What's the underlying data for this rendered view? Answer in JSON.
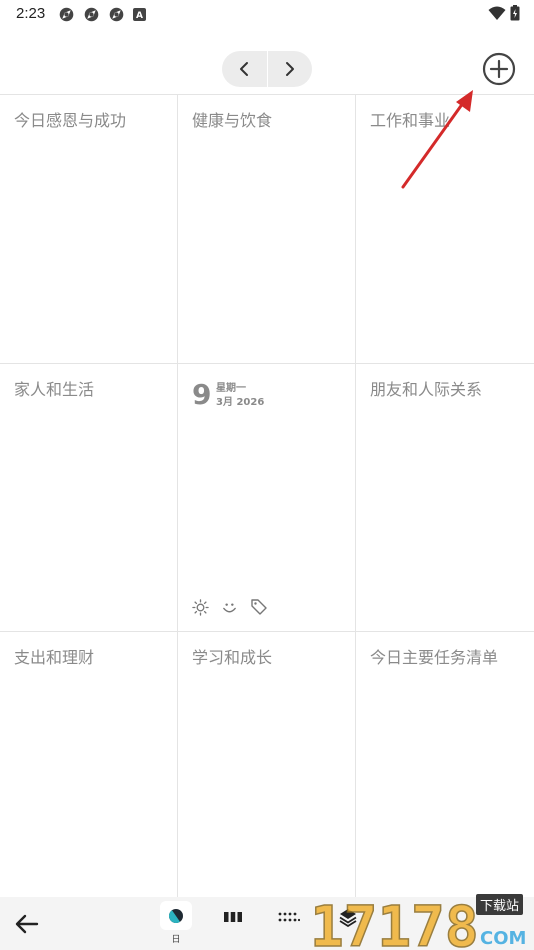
{
  "status_bar": {
    "time": "2:23"
  },
  "toolbar": {
    "prev_icon": "chevron-left-icon",
    "next_icon": "chevron-right-icon",
    "add_icon": "plus-circle-icon"
  },
  "grid": {
    "cells": [
      {
        "title": "今日感恩与成功"
      },
      {
        "title": "健康与饮食"
      },
      {
        "title": "工作和事业"
      },
      {
        "title": "家人和生活"
      },
      {
        "title": ""
      },
      {
        "title": "朋友和人际关系"
      },
      {
        "title": "支出和理财"
      },
      {
        "title": "学习和成长"
      },
      {
        "title": "今日主要任务清单"
      }
    ],
    "date": {
      "day": "9",
      "weekday": "星期一",
      "month_year": "3月 2026"
    },
    "center_icons": [
      "sun-icon",
      "smile-icon",
      "tag-icon"
    ]
  },
  "bottom_bar": {
    "day_label": "日",
    "views": [
      "day-view-icon",
      "week-view-icon",
      "month-view-icon",
      "layers-icon"
    ]
  },
  "watermark": {
    "text": "17178",
    "sub": "COM",
    "badge": "下载站"
  },
  "colors": {
    "annotation_arrow": "#d42a2a",
    "grid_line": "#e4e4e4",
    "label": "#8a8a8a"
  }
}
